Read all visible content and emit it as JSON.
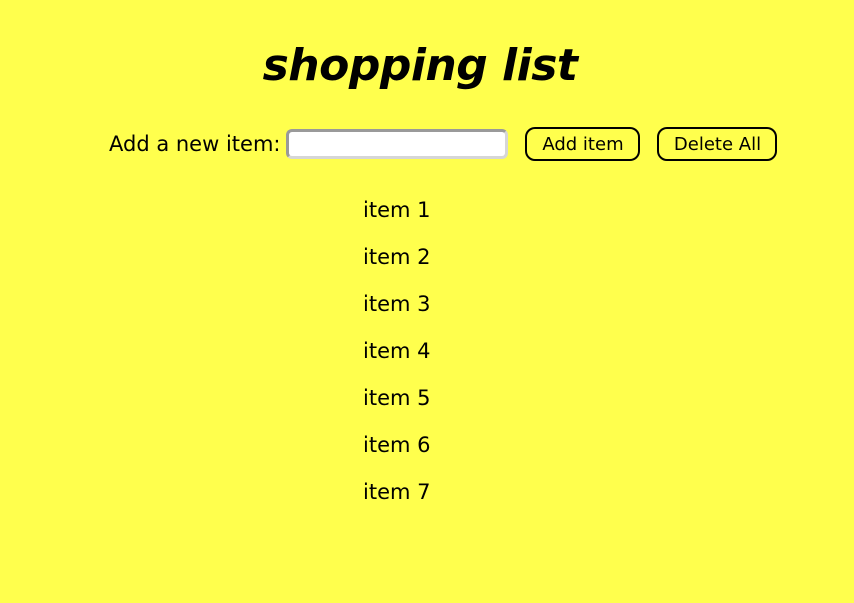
{
  "page": {
    "title": "shopping list",
    "background_color": "#ffff4d"
  },
  "form": {
    "label": "Add a new item:",
    "input_value": "",
    "input_placeholder": "",
    "add_button_label": "Add item",
    "delete_all_button_label": "Delete All"
  },
  "items": [
    "item 1",
    "item 2",
    "item 3",
    "item 4",
    "item 5",
    "item 6",
    "item 7"
  ]
}
